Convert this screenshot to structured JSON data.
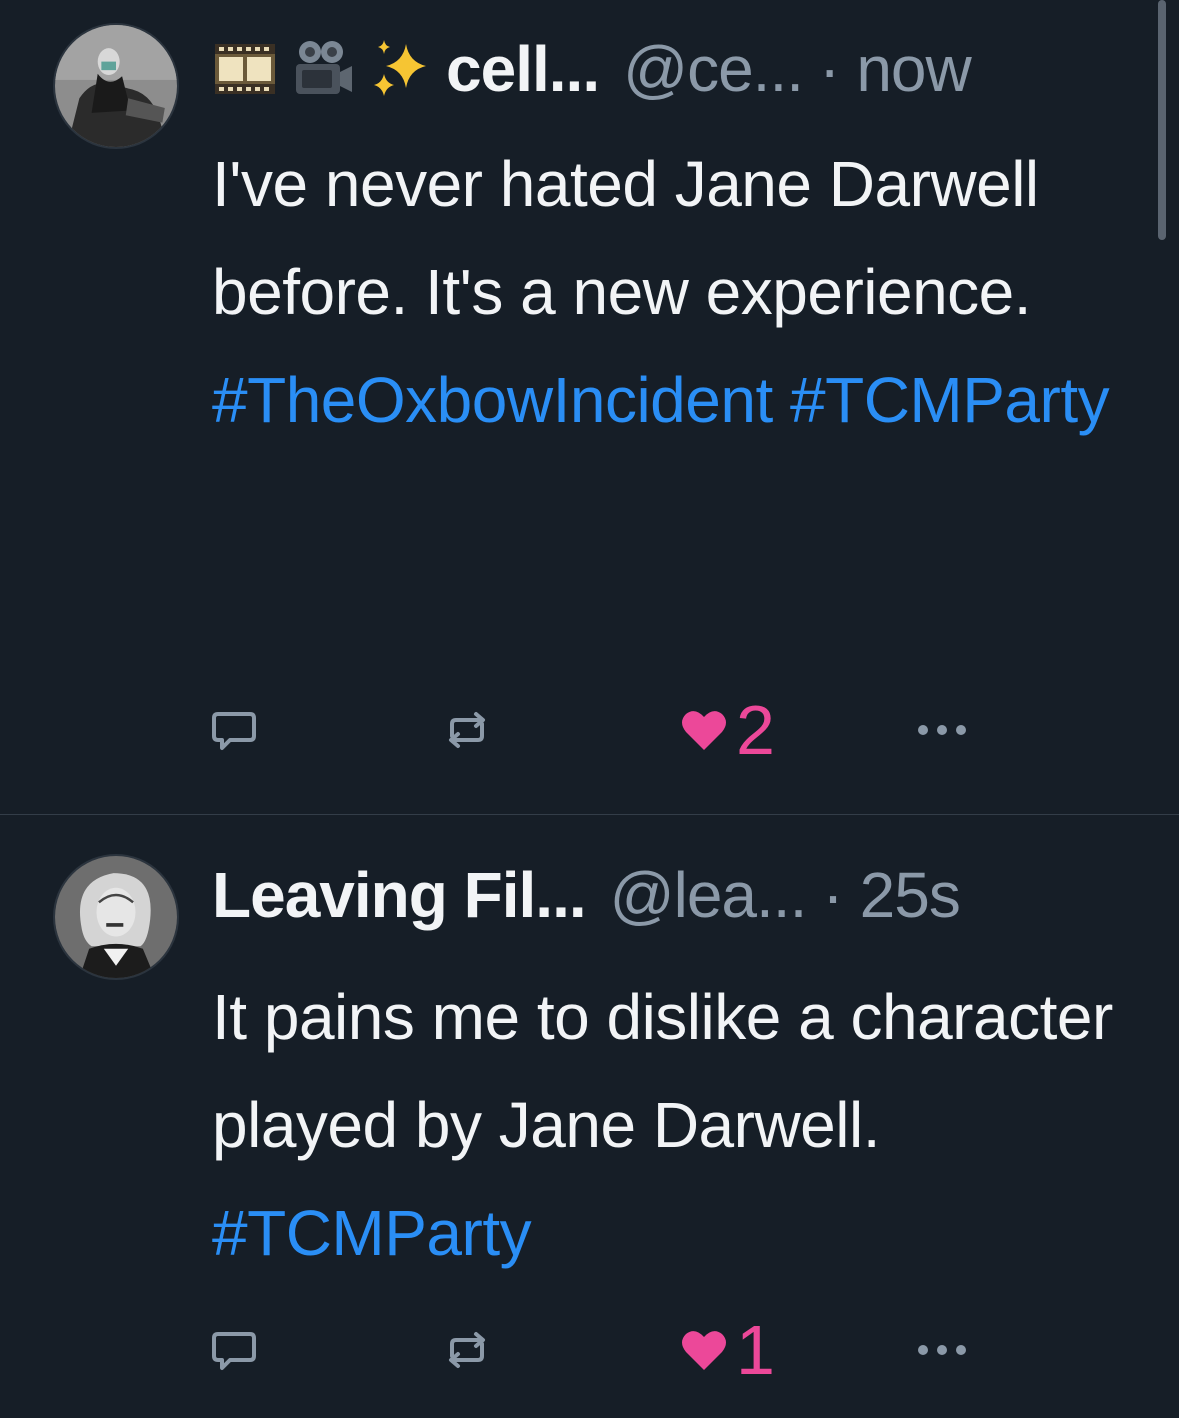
{
  "tweets": [
    {
      "name": "cell...",
      "handle": "@ce...",
      "separator": "·",
      "time": "now",
      "name_emojis": [
        "film-frames-icon",
        "movie-camera-icon",
        "sparkles-icon"
      ],
      "text_plain": "I've never hated Jane Darwell before. It's a new experience. ",
      "hashtags": [
        "#TheOxbowIncident",
        "#TCMParty"
      ],
      "likes": "2"
    },
    {
      "name": "Leaving Fil...",
      "handle": "@lea...",
      "separator": "·",
      "time": "25s",
      "text_plain": "It pains me to dislike a character played by Jane Darwell. ",
      "hashtags": [
        "#TCMParty"
      ],
      "likes": "1"
    }
  ],
  "colors": {
    "background": "#161e27",
    "text": "#f2f4f6",
    "muted": "#8b99a8",
    "link": "#2a8ef5",
    "like": "#ec4899",
    "divider": "#333d48"
  }
}
